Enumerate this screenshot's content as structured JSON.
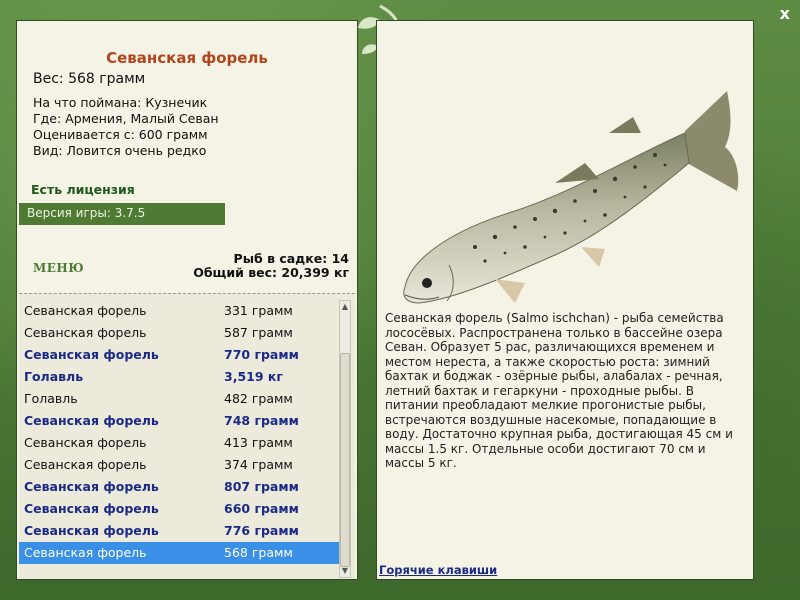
{
  "window": {
    "close_label": "x"
  },
  "fish": {
    "title": "Севанская форель",
    "weight": "Вес: 568 грамм",
    "caught_on": "На что поймана: Кузнечик",
    "location": "Где: Армения, Малый Севан",
    "valued_from": "Оценивается с: 600 грамм",
    "rarity": "Вид: Ловится очень редко",
    "description": "Севанская форель (Salmo ischchan) - рыба семейства лососёвых. Распространена только в бассейне озера Севан. Образует 5 рас, различающихся временем и местом нереста, а также скоростью роста: зимний бахтак и боджак - озёрные рыбы, алабалах - речная, летний бахтак и гегаркуни - проходные рыбы. В питании преобладают мелкие прогонистые рыбы, встречаются воздушные насекомые, попадающие в воду. Достаточно крупная рыба, достигающая 45 см и массы 1.5 кг. Отдельные особи достигают 70 см и массы 5 кг."
  },
  "license": "Есть лицензия",
  "version": "Версия игры: 3.7.5",
  "menu_label": "МЕНЮ",
  "keep": {
    "count": "Рыб в садке: 14",
    "total": "Общий вес: 20,399 кг"
  },
  "catch_list": [
    {
      "name": "Севанская форель",
      "weight": "331 грамм",
      "bold": false,
      "selected": false
    },
    {
      "name": "Севанская форель",
      "weight": "587 грамм",
      "bold": false,
      "selected": false
    },
    {
      "name": "Севанская форель",
      "weight": "770 грамм",
      "bold": true,
      "selected": false
    },
    {
      "name": "Голавль",
      "weight": "3,519 кг",
      "bold": true,
      "selected": false
    },
    {
      "name": "Голавль",
      "weight": "482 грамм",
      "bold": false,
      "selected": false
    },
    {
      "name": "Севанская форель",
      "weight": "748 грамм",
      "bold": true,
      "selected": false
    },
    {
      "name": "Севанская форель",
      "weight": "413 грамм",
      "bold": false,
      "selected": false
    },
    {
      "name": "Севанская форель",
      "weight": "374 грамм",
      "bold": false,
      "selected": false
    },
    {
      "name": "Севанская форель",
      "weight": "807 грамм",
      "bold": true,
      "selected": false
    },
    {
      "name": "Севанская форель",
      "weight": "660 грамм",
      "bold": true,
      "selected": false
    },
    {
      "name": "Севанская форель",
      "weight": "776 грамм",
      "bold": true,
      "selected": false
    },
    {
      "name": "Севанская форель",
      "weight": "568 грамм",
      "bold": false,
      "selected": true
    }
  ],
  "hotkeys_label": "Горячие клавиши",
  "colors": {
    "frame_green": "#4e7a34",
    "title_orange": "#b2441c",
    "highlight_blue": "#3a8fe6",
    "bold_navy": "#1b2a86"
  },
  "icons": {
    "close": "close-icon",
    "leaf": "leaf-decoration-icon",
    "scroll_up": "scroll-up-arrow-icon",
    "scroll_down": "scroll-down-arrow-icon"
  }
}
